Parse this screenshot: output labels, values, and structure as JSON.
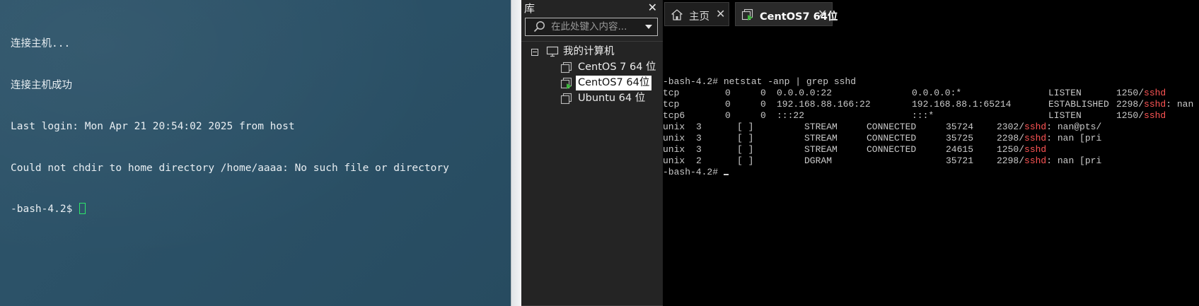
{
  "left_terminal": {
    "lines": [
      "连接主机...",
      "连接主机成功",
      "Last login: Mon Apr 21 20:54:02 2025 from host",
      "Could not chdir to home directory /home/aaaa: No such file or directory"
    ],
    "prompt": "-bash-4.2$ ",
    "cursor_color": "#2ee66b",
    "background_color": "#2b5167"
  },
  "library": {
    "title": "库",
    "search_placeholder": "在此处键入内容...",
    "tree": {
      "root_label": "我的计算机",
      "items": [
        {
          "label": "CentOS 7 64 位",
          "selected": false,
          "running": false
        },
        {
          "label": "CentOS7 64位",
          "selected": true,
          "running": true
        },
        {
          "label": "Ubuntu 64 位",
          "selected": false,
          "running": false
        }
      ]
    }
  },
  "vm_tabs": [
    {
      "label": "主页",
      "icon": "home-icon",
      "active": false
    },
    {
      "label": "CentOS7 64位",
      "icon": "vm-running-icon",
      "active": true
    }
  ],
  "vm_terminal": {
    "command_line": "-bash-4.2# netstat -anp | grep sshd",
    "prompt": "-bash-4.2# ",
    "highlight_color": "#ff5555",
    "tcp_rows": [
      {
        "proto": "tcp",
        "recv": "0",
        "send": "0",
        "local": "0.0.0.0:22",
        "foreign": "0.0.0.0:*",
        "state": "LISTEN",
        "pid": "1250/",
        "prog": "sshd",
        "rest": ""
      },
      {
        "proto": "tcp",
        "recv": "0",
        "send": "0",
        "local": "192.168.88.166:22",
        "foreign": "192.168.88.1:65214",
        "state": "ESTABLISHED",
        "pid": "2298/",
        "prog": "sshd",
        "rest": ": nan"
      },
      {
        "proto": "tcp6",
        "recv": "0",
        "send": "0",
        "local": ":::22",
        "foreign": ":::*",
        "state": "LISTEN",
        "pid": "1250/",
        "prog": "sshd",
        "rest": ""
      }
    ],
    "unix_rows": [
      {
        "proto": "unix",
        "refcnt": "3",
        "flags": "[ ]",
        "type": "STREAM",
        "state": "CONNECTED",
        "inode": "35724",
        "pid": "2302/",
        "prog": "sshd",
        "rest": ": nan@pts/"
      },
      {
        "proto": "unix",
        "refcnt": "3",
        "flags": "[ ]",
        "type": "STREAM",
        "state": "CONNECTED",
        "inode": "35725",
        "pid": "2298/",
        "prog": "sshd",
        "rest": ": nan [pri"
      },
      {
        "proto": "unix",
        "refcnt": "3",
        "flags": "[ ]",
        "type": "STREAM",
        "state": "CONNECTED",
        "inode": "24615",
        "pid": "1250/",
        "prog": "sshd",
        "rest": ""
      },
      {
        "proto": "unix",
        "refcnt": "2",
        "flags": "[ ]",
        "type": "DGRAM",
        "state": "",
        "inode": "35721",
        "pid": "2298/",
        "prog": "sshd",
        "rest": ": nan [pri"
      }
    ]
  }
}
